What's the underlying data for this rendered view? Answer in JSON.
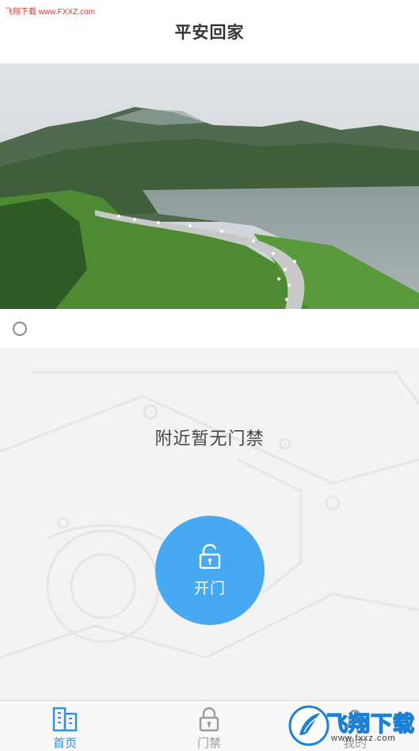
{
  "watermark_top": "飞翔下载 www.FXXZ.com",
  "header": {
    "title": "平安回家"
  },
  "banner": {
    "image": "mountain-lake-marathon-photo"
  },
  "carousel": {
    "indicator": "carousel-dot"
  },
  "main": {
    "empty_text": "附近暂无门禁",
    "open_button": {
      "label": "开门",
      "icon": "unlock-icon"
    }
  },
  "tabbar": {
    "tabs": [
      {
        "label": "首页",
        "icon": "building-icon",
        "active": true
      },
      {
        "label": "门禁",
        "icon": "lock-icon",
        "active": false
      },
      {
        "label": "我的",
        "icon": "user-icon",
        "active": false
      }
    ]
  },
  "watermark_bottom": {
    "text": "飞翔下载",
    "url": "www.fxxz.com"
  },
  "colors": {
    "accent": "#46a9f2",
    "tab_active": "#2b90e6",
    "watermark": "#e0322c"
  }
}
